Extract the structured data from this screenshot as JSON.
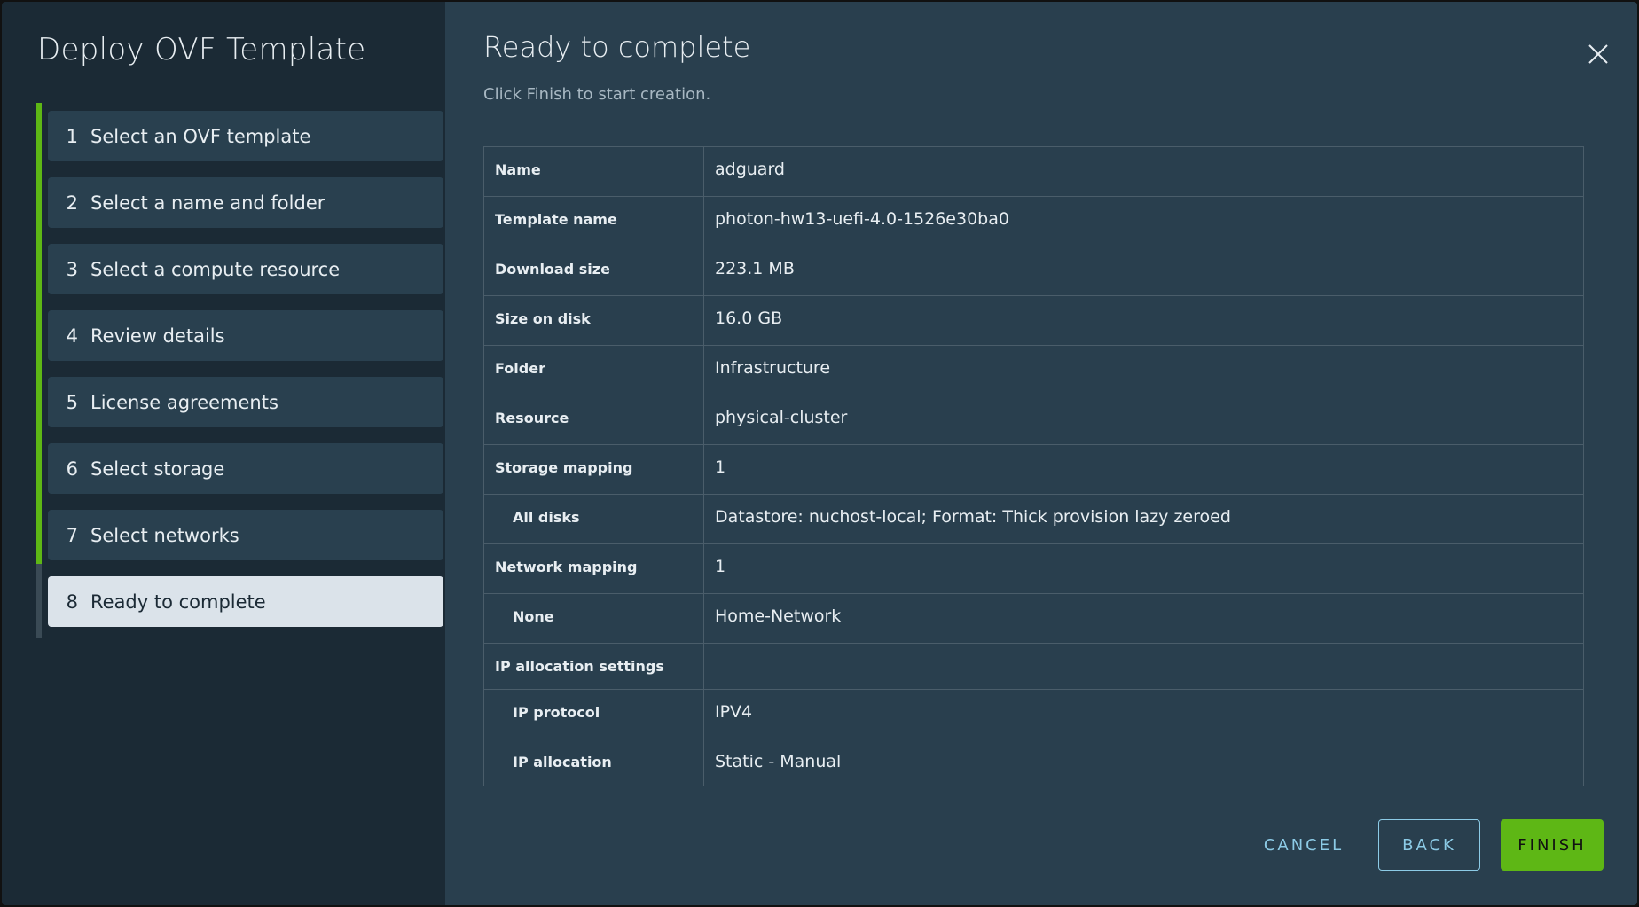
{
  "wizard": {
    "title": "Deploy OVF Template",
    "steps": [
      {
        "num": "1",
        "label": "Select an OVF template"
      },
      {
        "num": "2",
        "label": "Select a name and folder"
      },
      {
        "num": "3",
        "label": "Select a compute resource"
      },
      {
        "num": "4",
        "label": "Review details"
      },
      {
        "num": "5",
        "label": "License agreements"
      },
      {
        "num": "6",
        "label": "Select storage"
      },
      {
        "num": "7",
        "label": "Select networks"
      },
      {
        "num": "8",
        "label": "Ready to complete"
      }
    ],
    "active_step": 8
  },
  "main": {
    "title": "Ready to complete",
    "subtitle": "Click Finish to start creation.",
    "rows": [
      {
        "k": "Name",
        "v": "adguard"
      },
      {
        "k": "Template name",
        "v": "photon-hw13-uefi-4.0-1526e30ba0"
      },
      {
        "k": "Download size",
        "v": "223.1 MB"
      },
      {
        "k": "Size on disk",
        "v": "16.0 GB"
      },
      {
        "k": "Folder",
        "v": "Infrastructure"
      },
      {
        "k": "Resource",
        "v": "physical-cluster"
      },
      {
        "k": "Storage mapping",
        "v": "1"
      },
      {
        "k": "All disks",
        "v": "Datastore: nuchost-local; Format: Thick provision lazy zeroed"
      },
      {
        "k": "Network mapping",
        "v": "1"
      },
      {
        "k": "None",
        "v": "Home-Network"
      },
      {
        "k": "IP allocation settings",
        "v": ""
      },
      {
        "k": "IP protocol",
        "v": "IPV4"
      },
      {
        "k": "IP allocation",
        "v": "Static - Manual"
      }
    ]
  },
  "footer": {
    "cancel": "CANCEL",
    "back": "BACK",
    "finish": "FINISH"
  },
  "colors": {
    "accent": "#5eb715",
    "link": "#8ccbe6"
  }
}
